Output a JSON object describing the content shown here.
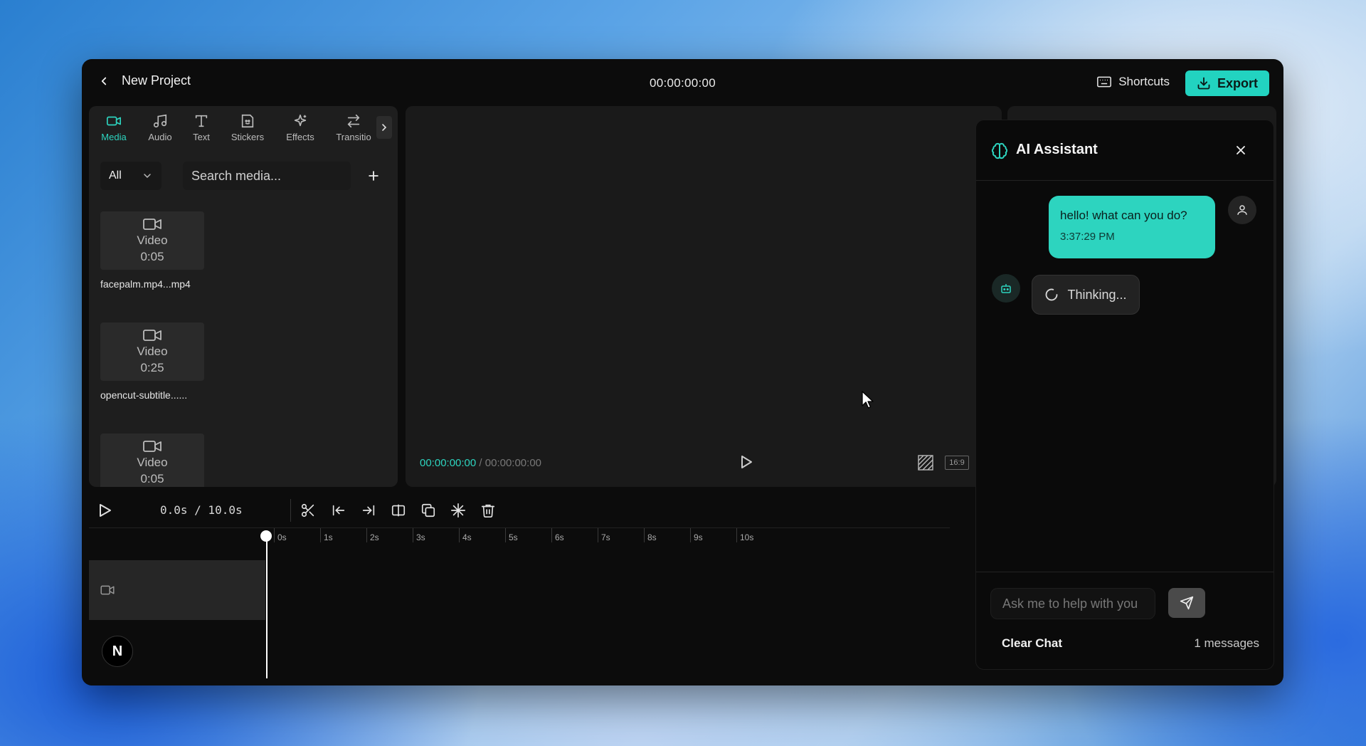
{
  "window": {
    "back_label": "New Project",
    "timecode": "00:00:00:00",
    "shortcuts_label": "Shortcuts",
    "export_label": "Export"
  },
  "media_panel": {
    "tabs": [
      {
        "label": "Media",
        "icon": "video-camera-icon",
        "active": true
      },
      {
        "label": "Audio",
        "icon": "music-note-icon"
      },
      {
        "label": "Text",
        "icon": "text-icon"
      },
      {
        "label": "Stickers",
        "icon": "sticker-icon"
      },
      {
        "label": "Effects",
        "icon": "sparkles-icon"
      },
      {
        "label": "Transitio",
        "icon": "arrows-left-right-icon"
      }
    ],
    "filter_value": "All",
    "search_placeholder": "Search media...",
    "items": [
      {
        "type": "Video",
        "duration": "0:05",
        "name": "facepalm.mp4...mp4"
      },
      {
        "type": "Video",
        "duration": "0:25",
        "name": "opencut-subtitle......"
      },
      {
        "type": "Video",
        "duration": "0:05",
        "name": ""
      }
    ]
  },
  "preview": {
    "current_time": "00:00:00:00",
    "separator": " / ",
    "total_time": "00:00:00:00",
    "aspect_ratio": "16:9"
  },
  "timeline": {
    "time_display": "0.0s / 10.0s",
    "ruler": [
      "0s",
      "1s",
      "2s",
      "3s",
      "4s",
      "5s",
      "6s",
      "7s",
      "8s",
      "9s",
      "10s"
    ],
    "badge": "N"
  },
  "ai": {
    "title": "AI Assistant",
    "user_message": "hello! what can you do?",
    "user_time": "3:37:29 PM",
    "thinking": "Thinking...",
    "input_placeholder": "Ask me to help with you",
    "clear_label": "Clear Chat",
    "count_label": "1 messages",
    "accent": "#2dd4bf"
  }
}
